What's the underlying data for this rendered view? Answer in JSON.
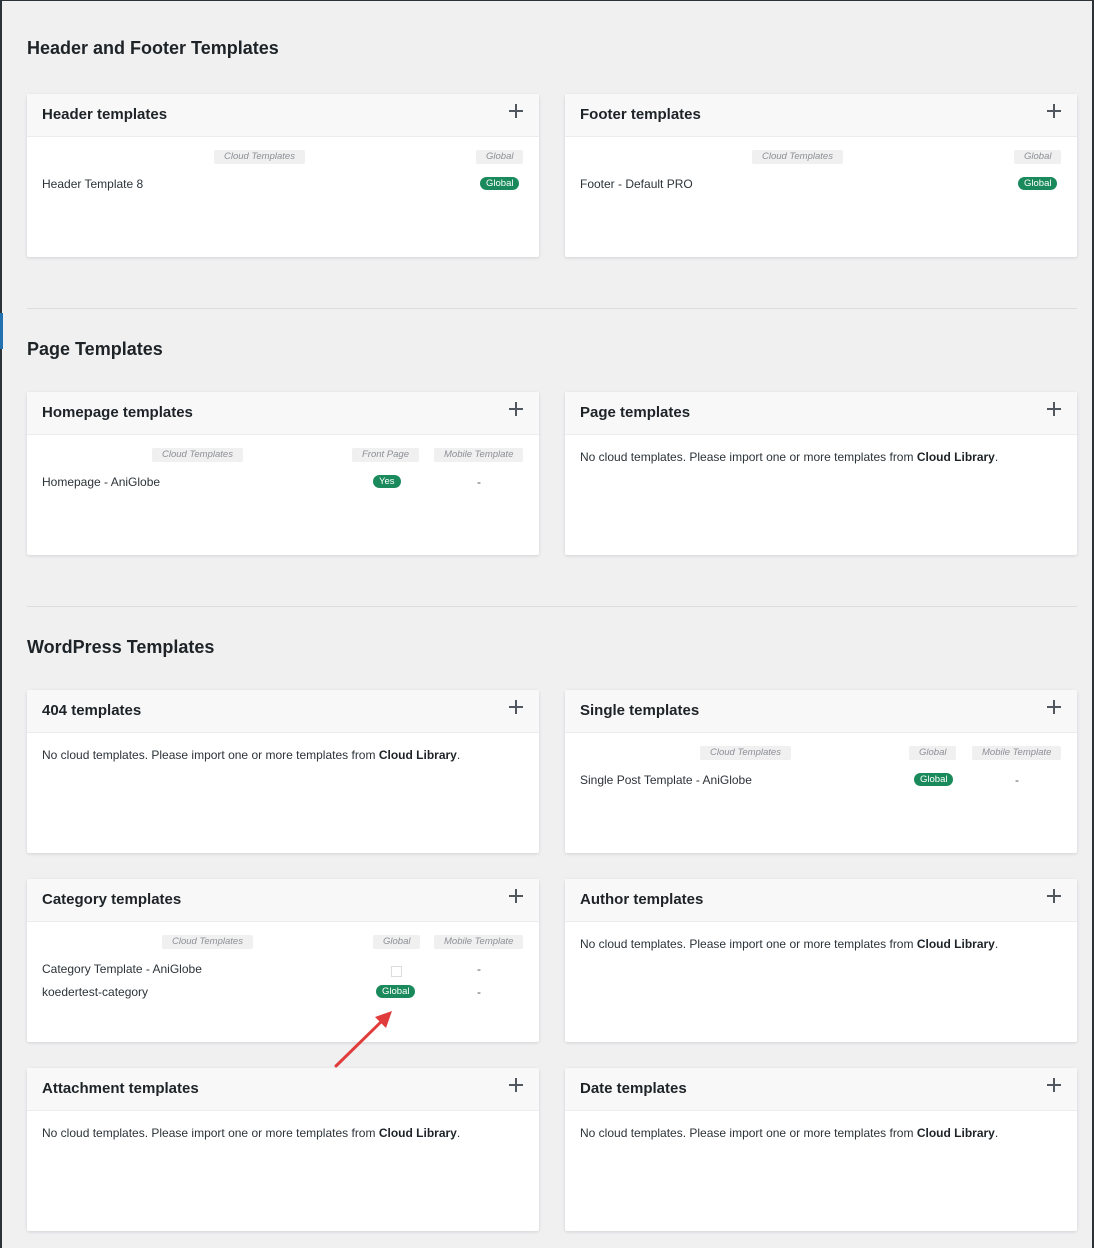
{
  "sections": {
    "header_footer": {
      "title": "Header and Footer Templates"
    },
    "page": {
      "title": "Page Templates"
    },
    "wordpress": {
      "title": "WordPress Templates"
    }
  },
  "cards": {
    "header": {
      "title": "Header templates",
      "columns": [
        "Cloud Templates",
        "Global"
      ],
      "rows": [
        {
          "name": "Header Template 8",
          "global": "Global"
        }
      ]
    },
    "footer": {
      "title": "Footer templates",
      "columns": [
        "Cloud Templates",
        "Global"
      ],
      "rows": [
        {
          "name": "Footer - Default PRO",
          "global": "Global"
        }
      ]
    },
    "homepage": {
      "title": "Homepage templates",
      "columns": [
        "Cloud Templates",
        "Front Page",
        "Mobile Template"
      ],
      "rows": [
        {
          "name": "Homepage - AniGlobe",
          "front_page": "Yes",
          "mobile": "-"
        }
      ]
    },
    "page": {
      "title": "Page templates",
      "empty_text": "No cloud templates. Please import one or more templates from ",
      "empty_link": "Cloud Library",
      "empty_end": "."
    },
    "t404": {
      "title": "404 templates",
      "empty_text": "No cloud templates. Please import one or more templates from ",
      "empty_link": "Cloud Library",
      "empty_end": "."
    },
    "single": {
      "title": "Single templates",
      "columns": [
        "Cloud Templates",
        "Global",
        "Mobile Template"
      ],
      "rows": [
        {
          "name": "Single Post Template - AniGlobe",
          "global": "Global",
          "mobile": "-"
        }
      ]
    },
    "category": {
      "title": "Category templates",
      "columns": [
        "Cloud Templates",
        "Global",
        "Mobile Template"
      ],
      "rows": [
        {
          "name": "Category Template - AniGlobe",
          "mobile": "-"
        },
        {
          "name": "koedertest-category",
          "global": "Global",
          "mobile": "-"
        }
      ]
    },
    "author": {
      "title": "Author templates",
      "empty_text": "No cloud templates. Please import one or more templates from ",
      "empty_link": "Cloud Library",
      "empty_end": "."
    },
    "attachment": {
      "title": "Attachment templates",
      "empty_text": "No cloud templates. Please import one or more templates from ",
      "empty_link": "Cloud Library",
      "empty_end": "."
    },
    "date": {
      "title": "Date templates",
      "empty_text": "No cloud templates. Please import one or more templates from ",
      "empty_link": "Cloud Library",
      "empty_end": "."
    }
  },
  "colors": {
    "badge_green": "#1a8a5c",
    "annotation_arrow": "#e03c3c"
  }
}
